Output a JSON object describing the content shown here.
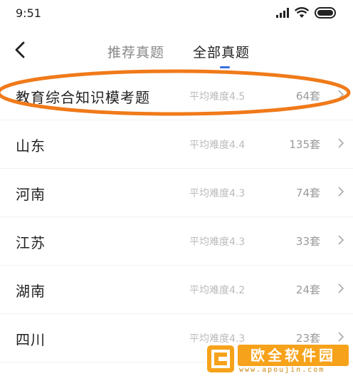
{
  "status_bar": {
    "time": "9:51"
  },
  "nav": {
    "tabs": [
      {
        "label": "推荐真题",
        "active": false
      },
      {
        "label": "全部真题",
        "active": true
      }
    ]
  },
  "list": {
    "items": [
      {
        "name": "教育综合知识模考题",
        "difficulty": "平均难度4.5",
        "count": "64套"
      },
      {
        "name": "山东",
        "difficulty": "平均难度4.4",
        "count": "135套"
      },
      {
        "name": "河南",
        "difficulty": "平均难度4.3",
        "count": "74套"
      },
      {
        "name": "江苏",
        "difficulty": "平均难度4.3",
        "count": "33套"
      },
      {
        "name": "湖南",
        "difficulty": "平均难度4.2",
        "count": "24套"
      },
      {
        "name": "四川",
        "difficulty": "平均难度4.3",
        "count": "23套"
      }
    ]
  },
  "watermark": {
    "title": "欧全软件园",
    "url": "www.apoujin.com"
  },
  "colors": {
    "annotation_ring": "#f07a1a",
    "tab_indicator": "#3b6fe0",
    "watermark": "#f6a21a"
  },
  "icons": [
    "signal-icon",
    "wifi-icon",
    "battery-icon",
    "back-arrow-icon",
    "chevron-right-icon"
  ]
}
